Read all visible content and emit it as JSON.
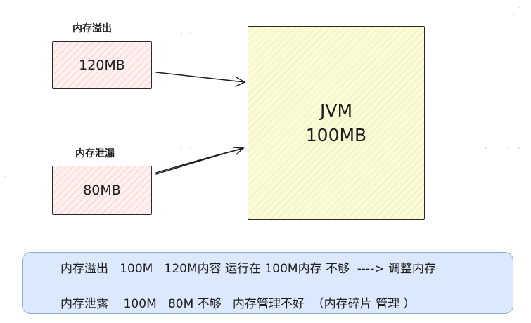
{
  "diagram": {
    "overflow": {
      "title": "内存溢出",
      "size": "120MB"
    },
    "leak": {
      "title": "内存泄漏",
      "size": "80MB"
    },
    "jvm": {
      "name": "JVM",
      "size": "100MB"
    }
  },
  "note": {
    "line1": "内存溢出   100M   120M内容 运行在 100M内存 不够  ----> 调整内存",
    "line2": "内存泄露    100M   80M 不够   内存管理不好  （内存碎片 管理 ）"
  },
  "colors": {
    "pink_fill": "#fff0f0",
    "jvm_fill": "#fbfbd8",
    "note_fill": "#dce8fb",
    "note_border": "#8aaedb"
  }
}
